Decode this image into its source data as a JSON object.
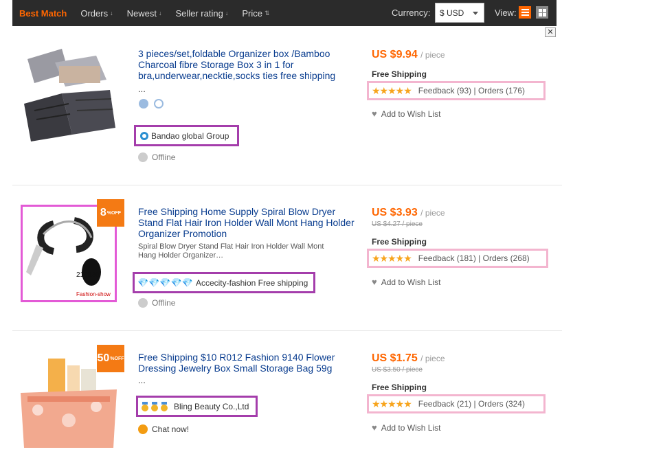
{
  "toolbar": {
    "sort_items": [
      {
        "label": "Best Match",
        "active": true
      },
      {
        "label": "Orders",
        "arrow": "↓"
      },
      {
        "label": "Newest",
        "arrow": "↓"
      },
      {
        "label": "Seller rating",
        "arrow": "↓"
      },
      {
        "label": "Price",
        "arrow": "⇅"
      }
    ],
    "currency_label": "Currency:",
    "currency_value": "$ USD",
    "view_label": "View:"
  },
  "close_label": "✕",
  "products": [
    {
      "title": "3 pieces/set,foldable Organizer box /Bamboo Charcoal fibre Storage Box 3 in 1 for bra,underwear,necktie,socks ties free shipping",
      "ellipsis": "...",
      "store": "Bandao global Group",
      "status": "Offline",
      "price": "US $9.94",
      "unit": "/ piece",
      "shipping": "Free Shipping",
      "feedback": "Feedback (93)",
      "orders": "Orders (176)",
      "wish": "Add to Wish List"
    },
    {
      "badge": "8",
      "badge_suffix": "%OFF",
      "title": "Free Shipping Home Supply Spiral Blow Dryer Stand Flat Hair Iron Holder Wall Mont Hang Holder Organizer Promotion",
      "desc": "Spiral Blow Dryer Stand Flat Hair Iron Holder Wall Mont Hang Holder Organizer…",
      "store": "Accecity-fashion Free shipping",
      "status": "Offline",
      "price": "US $3.93",
      "unit": "/ piece",
      "orig_price": "US $4.27 / piece",
      "shipping": "Free Shipping",
      "feedback": "Feedback (181)",
      "orders": "Orders (268)",
      "wish": "Add to Wish List",
      "thumb_label": "210520",
      "thumb_brand": "Fashion-show"
    },
    {
      "badge": "50",
      "badge_suffix": "%OFF",
      "title": "Free Shipping $10 R012 Fashion 9140 Flower Dressing Jewelry Box Small Storage Bag 59g",
      "ellipsis": "...",
      "store": "Bling Beauty Co.,Ltd",
      "status": "Chat now!",
      "price": "US $1.75",
      "unit": "/ piece",
      "orig_price": "US $3.50 / piece",
      "shipping": "Free Shipping",
      "feedback": "Feedback (21)",
      "orders": "Orders (324)",
      "wish": "Add to Wish List"
    }
  ],
  "colors": {
    "accent": "#ff6600",
    "toolbar": "#2b2b2b",
    "store_border": "#a43dab",
    "rating_border": "#f3b5cf",
    "title": "#0a3d8f"
  }
}
